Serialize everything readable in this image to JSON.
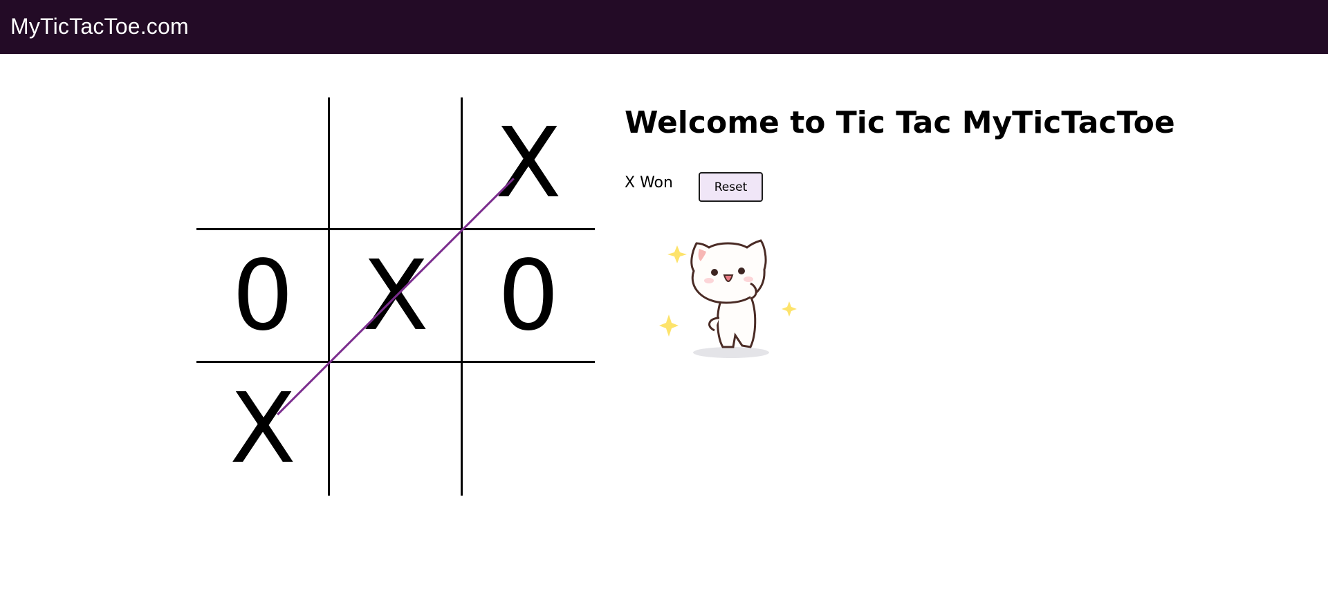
{
  "header": {
    "site_title": "MyTicTacToe.com",
    "background_color": "#230b26"
  },
  "board": {
    "cells": [
      "",
      "",
      "X",
      "0",
      "X",
      "0",
      "X",
      "",
      ""
    ],
    "winning_line": [
      2,
      4,
      6
    ],
    "win_line_color": "#7b2d8e"
  },
  "main": {
    "title": "Welcome to Tic Tac MyTicTacToe",
    "status": "X Won",
    "reset_label": "Reset",
    "reset_color": "#f0e6f7"
  },
  "mascot": {
    "icon": "happy-cat-sticker-icon"
  }
}
